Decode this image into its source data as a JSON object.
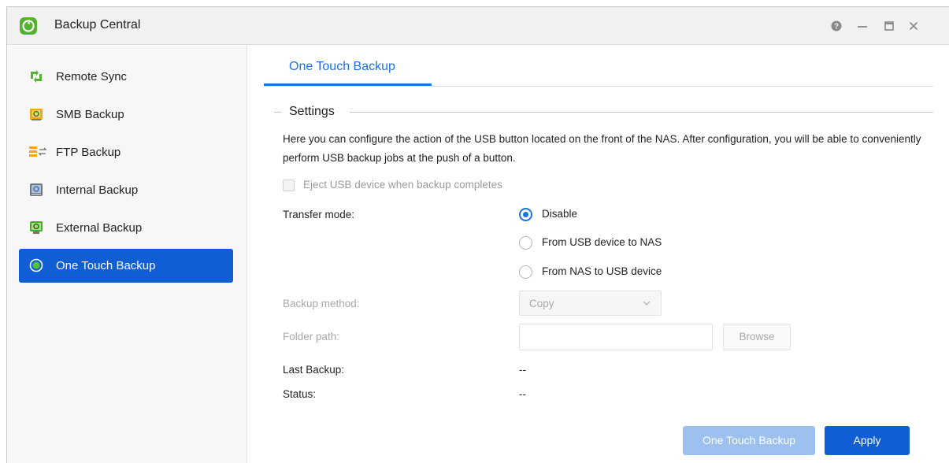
{
  "window": {
    "title": "Backup Central"
  },
  "title_controls": {
    "help": "?",
    "minimize": "—",
    "maximize": "□",
    "close": "✕"
  },
  "sidebar": {
    "items": [
      {
        "label": "Remote Sync",
        "icon": "remote-sync-icon",
        "active": false
      },
      {
        "label": "SMB Backup",
        "icon": "smb-backup-icon",
        "active": false
      },
      {
        "label": "FTP Backup",
        "icon": "ftp-backup-icon",
        "active": false
      },
      {
        "label": "Internal Backup",
        "icon": "internal-backup-icon",
        "active": false
      },
      {
        "label": "External Backup",
        "icon": "external-backup-icon",
        "active": false
      },
      {
        "label": "One Touch Backup",
        "icon": "one-touch-backup-icon",
        "active": true
      }
    ]
  },
  "main": {
    "tab": "One Touch Backup",
    "settings": {
      "legend": "Settings",
      "description": "Here you can configure the action of the USB button located on the front of the NAS. After configuration, you will be able to conveniently perform USB backup jobs at the push of a button.",
      "eject_checkbox": {
        "label": "Eject USB device when backup completes",
        "checked": false,
        "disabled": true
      },
      "transfer_mode": {
        "label": "Transfer mode:",
        "options": [
          "Disable",
          "From USB device to NAS",
          "From NAS to USB device"
        ],
        "selected": "Disable"
      },
      "backup_method": {
        "label": "Backup method:",
        "value": "Copy"
      },
      "folder_path": {
        "label": "Folder path:",
        "value": "",
        "browse_label": "Browse"
      },
      "last_backup": {
        "label": "Last Backup:",
        "value": "--"
      },
      "status": {
        "label": "Status:",
        "value": "--"
      }
    },
    "buttons": {
      "one_touch_backup": "One Touch Backup",
      "apply": "Apply"
    }
  },
  "colors": {
    "accent": "#1a72e8",
    "active_nav": "#0f5ed6",
    "apply": "#0f5ed6",
    "disabled_button": "#9cc1ef",
    "logo": "#55b231"
  }
}
